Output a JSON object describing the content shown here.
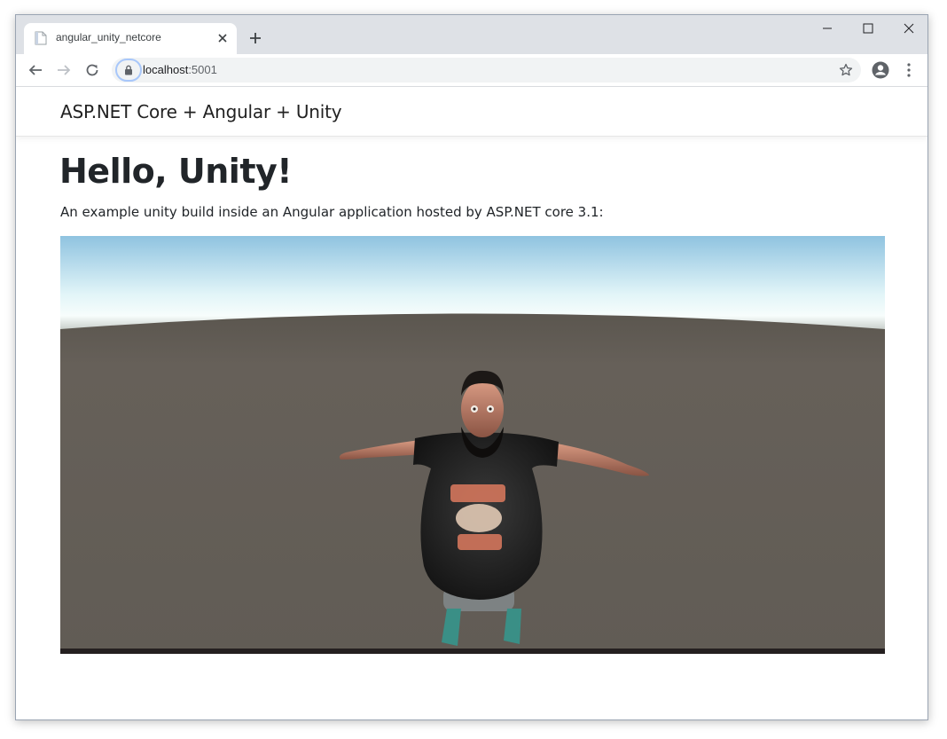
{
  "browser": {
    "tab_title": "angular_unity_netcore",
    "url_host": "localhost",
    "url_port": ":5001"
  },
  "app": {
    "brand": "ASP.NET Core + Angular + Unity",
    "heading": "Hello, Unity!",
    "lead": "An example unity build inside an Angular application hosted by ASP.NET core 3.1:"
  },
  "icons": {
    "tab_favicon": "document-icon",
    "tab_close": "close-icon",
    "new_tab": "plus-icon",
    "minimize": "minimize-icon",
    "maximize": "maximize-icon",
    "close_window": "close-icon",
    "back": "arrow-left-icon",
    "forward": "arrow-right-icon",
    "reload": "reload-icon",
    "lock": "lock-icon",
    "bookmark": "star-icon",
    "profile": "account-circle-icon",
    "menu": "kebab-menu-icon"
  },
  "colors": {
    "tabstrip": "#dee1e6",
    "omnibox": "#f1f3f4",
    "sky_top": "#8fc3e0",
    "ground": "#64605a"
  }
}
